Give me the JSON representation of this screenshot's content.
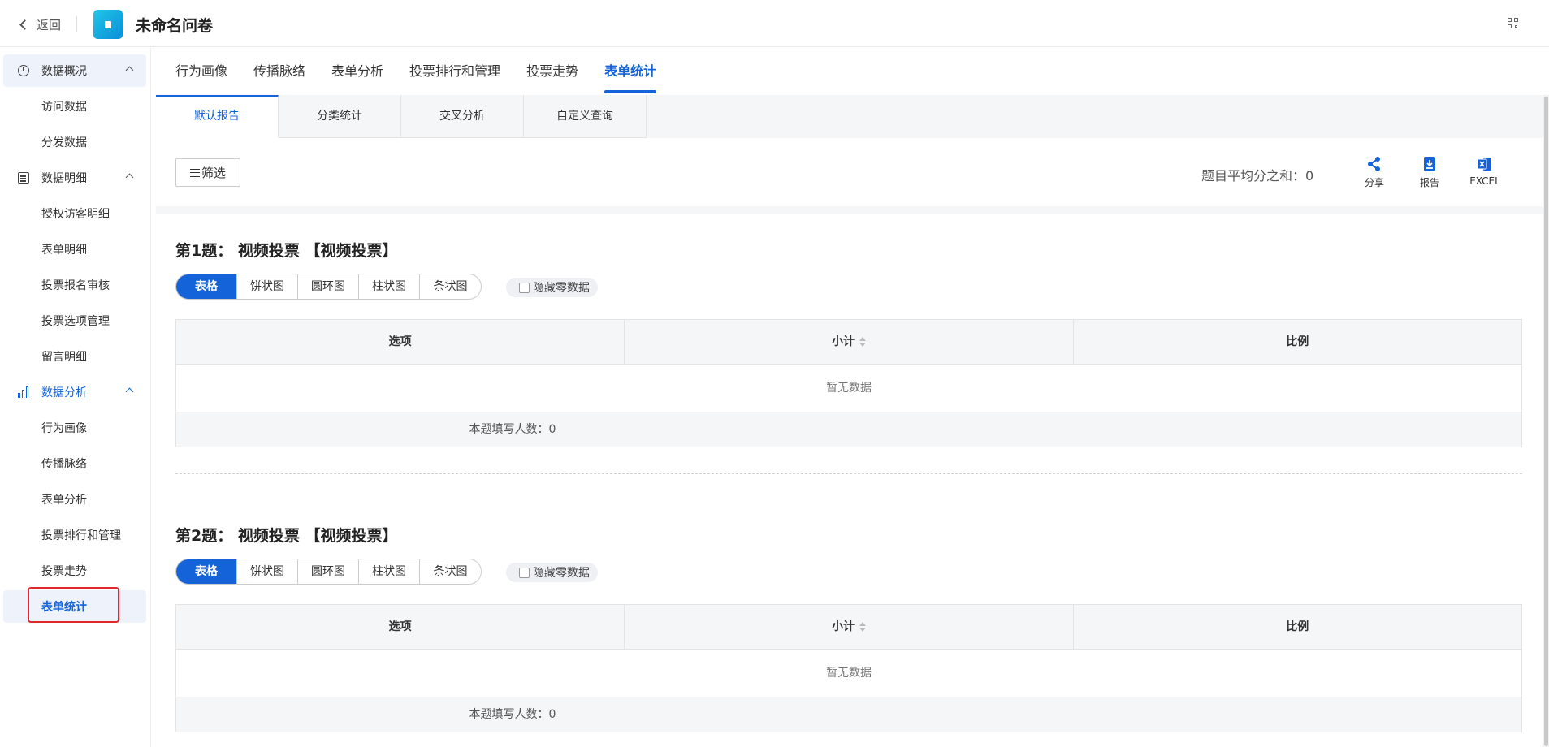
{
  "header": {
    "back_label": "返回",
    "title": "未命名问卷"
  },
  "sidebar": {
    "groups": [
      {
        "label": "数据概况",
        "icon": "pie-chart-icon",
        "items": [
          "访问数据",
          "分发数据"
        ]
      },
      {
        "label": "数据明细",
        "icon": "document-icon",
        "items": [
          "授权访客明细",
          "表单明细",
          "投票报名审核",
          "投票选项管理",
          "留言明细"
        ]
      },
      {
        "label": "数据分析",
        "icon": "bar-chart-icon",
        "items": [
          "行为画像",
          "传播脉络",
          "表单分析",
          "投票排行和管理",
          "投票走势",
          "表单统计"
        ]
      }
    ],
    "current_item": "表单统计"
  },
  "main_tabs": [
    "行为画像",
    "传播脉络",
    "表单分析",
    "投票排行和管理",
    "投票走势",
    "表单统计"
  ],
  "active_main_tab": "表单统计",
  "sub_tabs": [
    "默认报告",
    "分类统计",
    "交叉分析",
    "自定义查询"
  ],
  "active_sub_tab": "默认报告",
  "toolbar": {
    "filter_label": "筛选",
    "avg_label": "题目平均分之和：0",
    "share_label": "分享",
    "report_label": "报告",
    "excel_label": "EXCEL"
  },
  "questions": [
    {
      "title": "第1题：  视频投票  【视频投票】",
      "view_modes": [
        "表格",
        "饼状图",
        "圆环图",
        "柱状图",
        "条状图"
      ],
      "active_view": "表格",
      "hide_zero_label": "隐藏零数据",
      "columns": [
        "选项",
        "小计",
        "比例"
      ],
      "empty_text": "暂无数据",
      "footer": "本题填写人数：0"
    },
    {
      "title": "第2题：  视频投票  【视频投票】",
      "view_modes": [
        "表格",
        "饼状图",
        "圆环图",
        "柱状图",
        "条状图"
      ],
      "active_view": "表格",
      "hide_zero_label": "隐藏零数据",
      "columns": [
        "选项",
        "小计",
        "比例"
      ],
      "empty_text": "暂无数据",
      "footer": "本题填写人数：0"
    }
  ],
  "colors": {
    "accent": "#1463d9",
    "highlight": "#e0262c"
  }
}
